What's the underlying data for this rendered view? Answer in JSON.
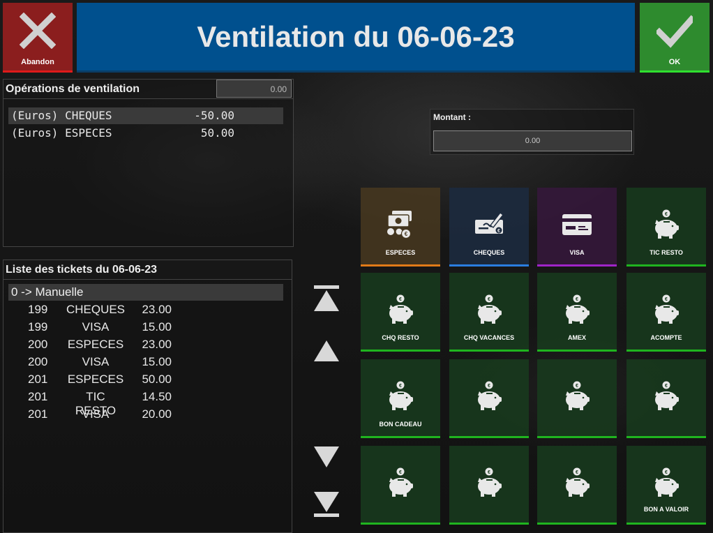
{
  "header": {
    "cancel_label": "Abandon",
    "title": "Ventilation du 06-06-23",
    "ok_label": "OK"
  },
  "operations": {
    "title": "Opérations de ventilation",
    "total": "0.00",
    "rows": [
      {
        "label": "(Euros) CHEQUES",
        "amount": "-50.00"
      },
      {
        "label": "(Euros) ESPECES",
        "amount": "50.00"
      }
    ]
  },
  "tickets": {
    "title": "Liste des tickets du 06-06-23",
    "group": "0 -> Manuelle",
    "rows": [
      {
        "num": "199",
        "mode": "CHEQUES",
        "amount": "23.00"
      },
      {
        "num": "199",
        "mode": "VISA",
        "amount": "15.00"
      },
      {
        "num": "200",
        "mode": "ESPECES",
        "amount": "23.00"
      },
      {
        "num": "200",
        "mode": "VISA",
        "amount": "15.00"
      },
      {
        "num": "201",
        "mode": "ESPECES",
        "amount": "50.00"
      },
      {
        "num": "201",
        "mode": "TIC RESTO",
        "amount": "14.50"
      },
      {
        "num": "201",
        "mode": "VISA",
        "amount": "20.00"
      }
    ]
  },
  "montant": {
    "label": "Montant :",
    "value": "0.00"
  },
  "payment_modes": [
    {
      "label": "ESPECES",
      "icon": "cash-icon",
      "accent": "#e07a18"
    },
    {
      "label": "CHEQUES",
      "icon": "cheque-icon",
      "accent": "#2a7ee0"
    },
    {
      "label": "VISA",
      "icon": "credit-card-icon",
      "accent": "#a024c8"
    },
    {
      "label": "TIC RESTO",
      "icon": "piggy-bank-icon",
      "accent": "#1fb41f"
    },
    {
      "label": "CHQ RESTO",
      "icon": "piggy-bank-icon",
      "accent": "#1fb41f"
    },
    {
      "label": "CHQ VACANCES",
      "icon": "piggy-bank-icon",
      "accent": "#1fb41f"
    },
    {
      "label": "AMEX",
      "icon": "piggy-bank-icon",
      "accent": "#1fb41f"
    },
    {
      "label": "ACOMPTE",
      "icon": "piggy-bank-icon",
      "accent": "#1fb41f"
    },
    {
      "label": "BON CADEAU",
      "icon": "piggy-bank-icon",
      "accent": "#1fb41f"
    },
    {
      "label": "",
      "icon": "piggy-bank-icon",
      "accent": "#1fb41f"
    },
    {
      "label": "",
      "icon": "piggy-bank-icon",
      "accent": "#1fb41f"
    },
    {
      "label": "",
      "icon": "piggy-bank-icon",
      "accent": "#1fb41f"
    },
    {
      "label": "",
      "icon": "piggy-bank-icon",
      "accent": "#1fb41f"
    },
    {
      "label": "",
      "icon": "piggy-bank-icon",
      "accent": "#1fb41f"
    },
    {
      "label": "",
      "icon": "piggy-bank-icon",
      "accent": "#1fb41f"
    },
    {
      "label": "BON A VALOIR",
      "icon": "piggy-bank-icon",
      "accent": "#1fb41f"
    }
  ],
  "colors": {
    "title_bar": "#00508e",
    "cancel": "#8b1e1e",
    "ok": "#2e8b2e",
    "tile_green": "#183a1e"
  }
}
